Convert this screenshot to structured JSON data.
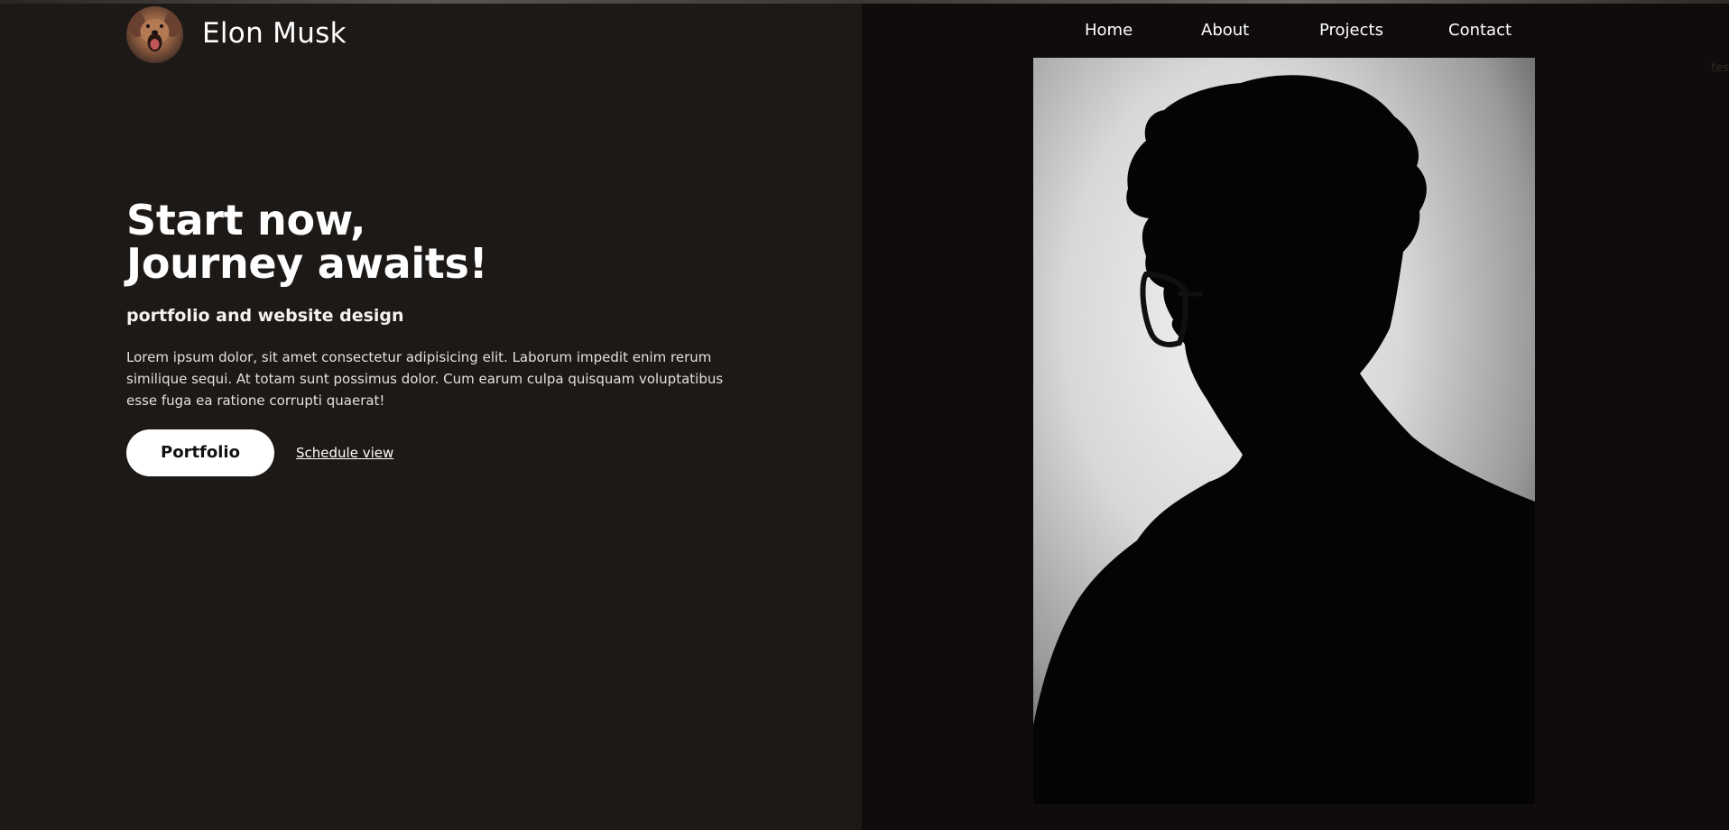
{
  "header": {
    "brand_name": "Elon Musk",
    "logo_icon": "dog-avatar-icon"
  },
  "nav": {
    "items": [
      {
        "label": "Home"
      },
      {
        "label": "About"
      },
      {
        "label": "Projects"
      },
      {
        "label": "Contact"
      }
    ]
  },
  "hero": {
    "title_line1": "Start now,",
    "title_line2": "Journey awaits!",
    "subtitle": "portfolio and website design",
    "body": "Lorem ipsum dolor, sit amet consectetur adipisicing elit. Laborum impedit enim rerum similique sequi. At totam sunt possimus dolor. Cum earum culpa quisquam voluptatibus esse fuga ea ratione corrupti quaerat!",
    "primary_button": "Portfolio",
    "secondary_link": "Schedule view"
  },
  "corner": {
    "text": "tes"
  },
  "colors": {
    "left_background": "#1d1917",
    "right_background": "#0f0c0b",
    "text": "#ffffff",
    "button_background": "#ffffff",
    "button_text": "#111111"
  }
}
